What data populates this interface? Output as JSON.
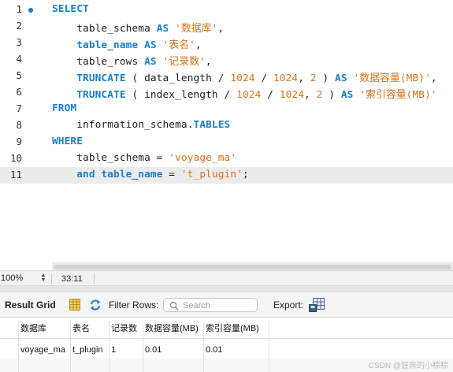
{
  "editor": {
    "lines": [
      {
        "num": "1",
        "tokens": [
          {
            "t": "SELECT",
            "c": "kw"
          }
        ]
      },
      {
        "num": "2",
        "tokens": [
          {
            "t": "    table_schema "
          },
          {
            "t": "AS",
            "c": "kw"
          },
          {
            "t": " "
          },
          {
            "t": "'数据库'",
            "c": "str"
          },
          {
            "t": ","
          }
        ]
      },
      {
        "num": "3",
        "tokens": [
          {
            "t": "    "
          },
          {
            "t": "table_name",
            "c": "kw"
          },
          {
            "t": " "
          },
          {
            "t": "AS",
            "c": "kw"
          },
          {
            "t": " "
          },
          {
            "t": "'表名'",
            "c": "str"
          },
          {
            "t": ","
          }
        ]
      },
      {
        "num": "4",
        "tokens": [
          {
            "t": "    table_rows "
          },
          {
            "t": "AS",
            "c": "kw"
          },
          {
            "t": " "
          },
          {
            "t": "'记录数'",
            "c": "str"
          },
          {
            "t": ","
          }
        ]
      },
      {
        "num": "5",
        "tokens": [
          {
            "t": "    "
          },
          {
            "t": "TRUNCATE",
            "c": "kw"
          },
          {
            "t": " ( data_length / "
          },
          {
            "t": "1024",
            "c": "num"
          },
          {
            "t": " / "
          },
          {
            "t": "1024",
            "c": "num"
          },
          {
            "t": ", "
          },
          {
            "t": "2",
            "c": "num"
          },
          {
            "t": " ) "
          },
          {
            "t": "AS",
            "c": "kw"
          },
          {
            "t": " "
          },
          {
            "t": "'数据容量(MB)'",
            "c": "str"
          },
          {
            "t": ","
          }
        ]
      },
      {
        "num": "6",
        "tokens": [
          {
            "t": "    "
          },
          {
            "t": "TRUNCATE",
            "c": "kw"
          },
          {
            "t": " ( index_length / "
          },
          {
            "t": "1024",
            "c": "num"
          },
          {
            "t": " / "
          },
          {
            "t": "1024",
            "c": "num"
          },
          {
            "t": ", "
          },
          {
            "t": "2",
            "c": "num"
          },
          {
            "t": " ) "
          },
          {
            "t": "AS",
            "c": "kw"
          },
          {
            "t": " "
          },
          {
            "t": "'索引容量(MB)'",
            "c": "str"
          }
        ]
      },
      {
        "num": "7",
        "tokens": [
          {
            "t": "FROM",
            "c": "kw"
          }
        ]
      },
      {
        "num": "8",
        "tokens": [
          {
            "t": "    information_schema."
          },
          {
            "t": "TABLES",
            "c": "kw"
          }
        ]
      },
      {
        "num": "9",
        "tokens": [
          {
            "t": "WHERE",
            "c": "kw"
          }
        ]
      },
      {
        "num": "10",
        "tokens": [
          {
            "t": "    table_schema = "
          },
          {
            "t": "'voyage_ma'",
            "c": "str"
          }
        ]
      },
      {
        "num": "11",
        "tokens": [
          {
            "t": "    "
          },
          {
            "t": "and",
            "c": "kw"
          },
          {
            "t": " "
          },
          {
            "t": "table_name",
            "c": "kw"
          },
          {
            "t": " = "
          },
          {
            "t": "'t_plugin'",
            "c": "str"
          },
          {
            "t": ";"
          }
        ]
      }
    ],
    "active_line": "11",
    "marker_line": "1"
  },
  "statusbar": {
    "zoom": "100%",
    "cursor": "33:11"
  },
  "result_toolbar": {
    "title": "Result Grid",
    "filter_label": "Filter Rows:",
    "search_placeholder": "Search",
    "export_label": "Export:"
  },
  "results": {
    "columns": [
      "数据库",
      "表名",
      "记录数",
      "数据容量(MB)",
      "索引容量(MB)"
    ],
    "rows": [
      [
        "voyage_ma",
        "t_plugin",
        "1",
        "0.01",
        "0.01"
      ]
    ]
  },
  "watermark": "CSDN @狂奔的小棕棕",
  "colors": {
    "keyword": "#1c7ec9",
    "string": "#d9701c",
    "marker": "#1f6fd1"
  }
}
